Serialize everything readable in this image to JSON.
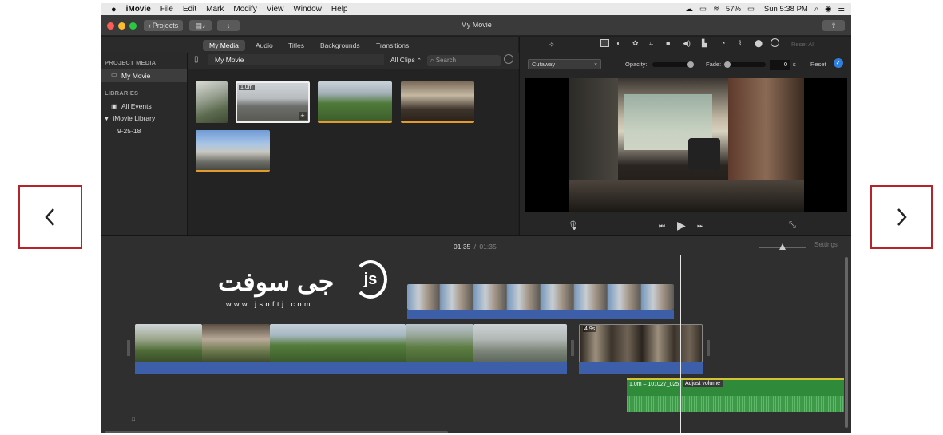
{
  "nav": {
    "prev_glyph": "‹",
    "next_glyph": "›"
  },
  "menubar": {
    "apple": "",
    "items": [
      "iMovie",
      "File",
      "Edit",
      "Mark",
      "Modify",
      "View",
      "Window",
      "Help"
    ],
    "battery": "57%",
    "clock": "Sun 5:38 PM"
  },
  "titlebar": {
    "projects_label": "Projects",
    "title": "My Movie"
  },
  "tabs": [
    "My Media",
    "Audio",
    "Titles",
    "Backgrounds",
    "Transitions"
  ],
  "sidebar": {
    "project_media_header": "PROJECT MEDIA",
    "project_item": "My Movie",
    "libraries_header": "LIBRARIES",
    "all_events": "All Events",
    "library": "iMovie Library",
    "event": "9-25-18"
  },
  "browser": {
    "title": "My Movie",
    "filter": "All Clips",
    "search_placeholder": "Search",
    "selected_duration": "1.0m"
  },
  "viewer": {
    "overlay_mode": "Cutaway",
    "opacity_label": "Opacity:",
    "fade_label": "Fade:",
    "fade_value": "0",
    "fade_unit": "s",
    "reset_label": "Reset",
    "reset_all_label": "Reset All"
  },
  "timeline": {
    "current_time": "01:35",
    "separator": "/",
    "total_time": "01:35",
    "settings_label": "Settings",
    "clip_duration_label": "4.9s",
    "audio_clip_label": "1.0m – 101027_0251",
    "tooltip": "Adjust volume"
  },
  "watermark": {
    "brand": "جی سوفت",
    "logo_text": "js",
    "url": "w w w . j s o f t j . c o m"
  }
}
